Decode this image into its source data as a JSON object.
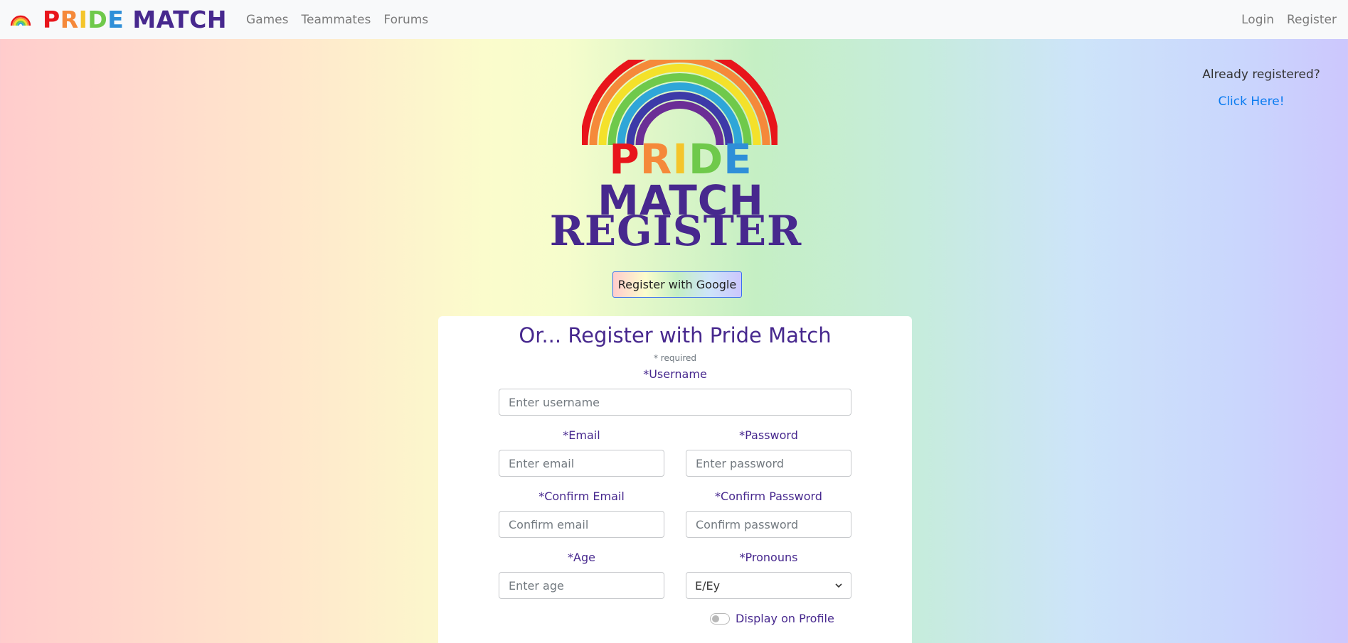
{
  "navbar": {
    "brand": [
      "P",
      "R",
      "I",
      "D",
      "E",
      "MATCH"
    ],
    "links": [
      "Games",
      "Teammates",
      "Forums"
    ],
    "right_links": [
      "Login",
      "Register"
    ]
  },
  "sidebar": {
    "already_text": "Already registered?",
    "click_here": "Click Here!"
  },
  "hero": {
    "logo": [
      "P",
      "R",
      "I",
      "D",
      "E",
      "MATCH"
    ],
    "title": "REGISTER",
    "google_button": "Register with Google"
  },
  "form": {
    "title": "Or... Register with Pride Match",
    "required_note": "* required",
    "username_label": "*Username",
    "username_placeholder": "Enter username",
    "email_label": "*Email",
    "email_placeholder": "Enter email",
    "password_label": "*Password",
    "password_placeholder": "Enter password",
    "confirm_email_label": "*Confirm Email",
    "confirm_email_placeholder": "Confirm email",
    "confirm_password_label": "*Confirm Password",
    "confirm_password_placeholder": "Confirm password",
    "age_label": "*Age",
    "age_placeholder": "Enter age",
    "pronouns_label": "*Pronouns",
    "pronouns_value": "E/Ey",
    "display_on_profile": "Display on Profile"
  },
  "colors": {
    "purple": "#47288e",
    "link_blue": "#0a7bf0",
    "rainbow": [
      "#e8151b",
      "#f5893a",
      "#f4e12a",
      "#6fc94b",
      "#2fa6d8",
      "#3d3aa8",
      "#6b2e96"
    ]
  }
}
